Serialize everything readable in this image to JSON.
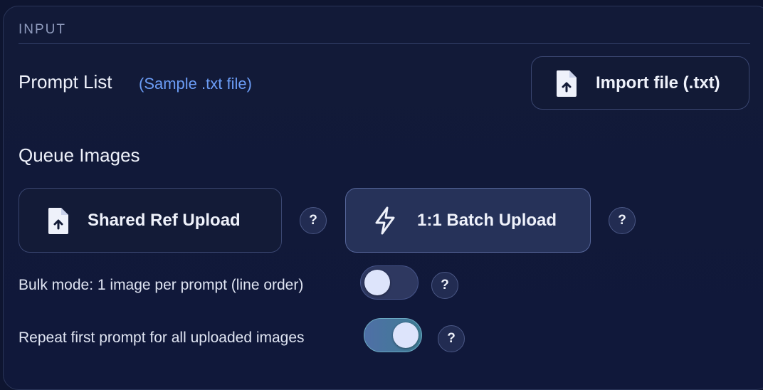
{
  "section": {
    "title": "INPUT"
  },
  "prompt_list": {
    "label": "Prompt List",
    "sample_link": "(Sample .txt file)",
    "import_button": {
      "label": "Import file (.txt)",
      "icon": "file-upload-icon"
    }
  },
  "queue_images": {
    "label": "Queue Images",
    "shared_button": {
      "label": "Shared Ref Upload",
      "icon": "file-upload-icon"
    },
    "batch_button": {
      "label": "1:1 Batch Upload",
      "icon": "lightning-icon"
    },
    "help_text": "?"
  },
  "options": {
    "bulk_mode": {
      "label": "Bulk mode: 1 image per prompt (line order)",
      "enabled": false
    },
    "repeat_first": {
      "label": "Repeat first prompt for all uploaded images",
      "enabled": true
    }
  },
  "colors": {
    "background": "#0e1530",
    "accent_link": "#6b9cf5",
    "active_button": "#263259",
    "toggle_on": "#4f6fa6"
  }
}
